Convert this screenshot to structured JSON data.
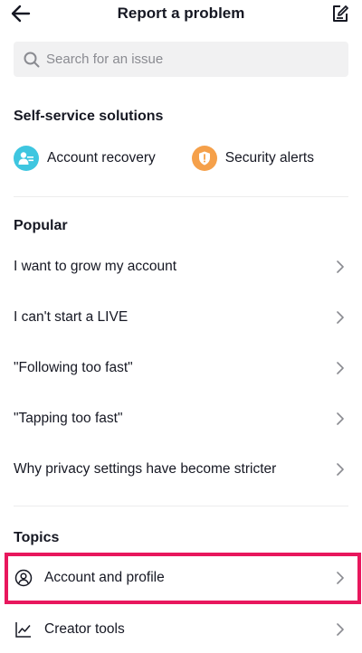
{
  "header": {
    "title": "Report a problem",
    "back_icon": "arrow-left-icon",
    "edit_icon": "edit-report-icon"
  },
  "search": {
    "placeholder": "Search for an issue",
    "value": ""
  },
  "self_service": {
    "title": "Self-service solutions",
    "items": [
      {
        "label": "Account recovery",
        "icon": "account-recovery-icon",
        "color": "#3ec6e0"
      },
      {
        "label": "Security alerts",
        "icon": "shield-icon",
        "color": "#f5a04a"
      }
    ]
  },
  "popular": {
    "title": "Popular",
    "items": [
      {
        "label": "I want to grow my account"
      },
      {
        "label": "I can't start a LIVE"
      },
      {
        "label": "\"Following too fast\""
      },
      {
        "label": "\"Tapping too fast\""
      },
      {
        "label": "Why privacy settings have become stricter"
      }
    ]
  },
  "topics": {
    "title": "Topics",
    "items": [
      {
        "label": "Account and profile",
        "icon": "user-circle-icon"
      },
      {
        "label": "Creator tools",
        "icon": "chart-line-icon"
      }
    ]
  },
  "colors": {
    "highlight": "#e8175d",
    "text": "#161823",
    "muted": "#8a8b91"
  }
}
